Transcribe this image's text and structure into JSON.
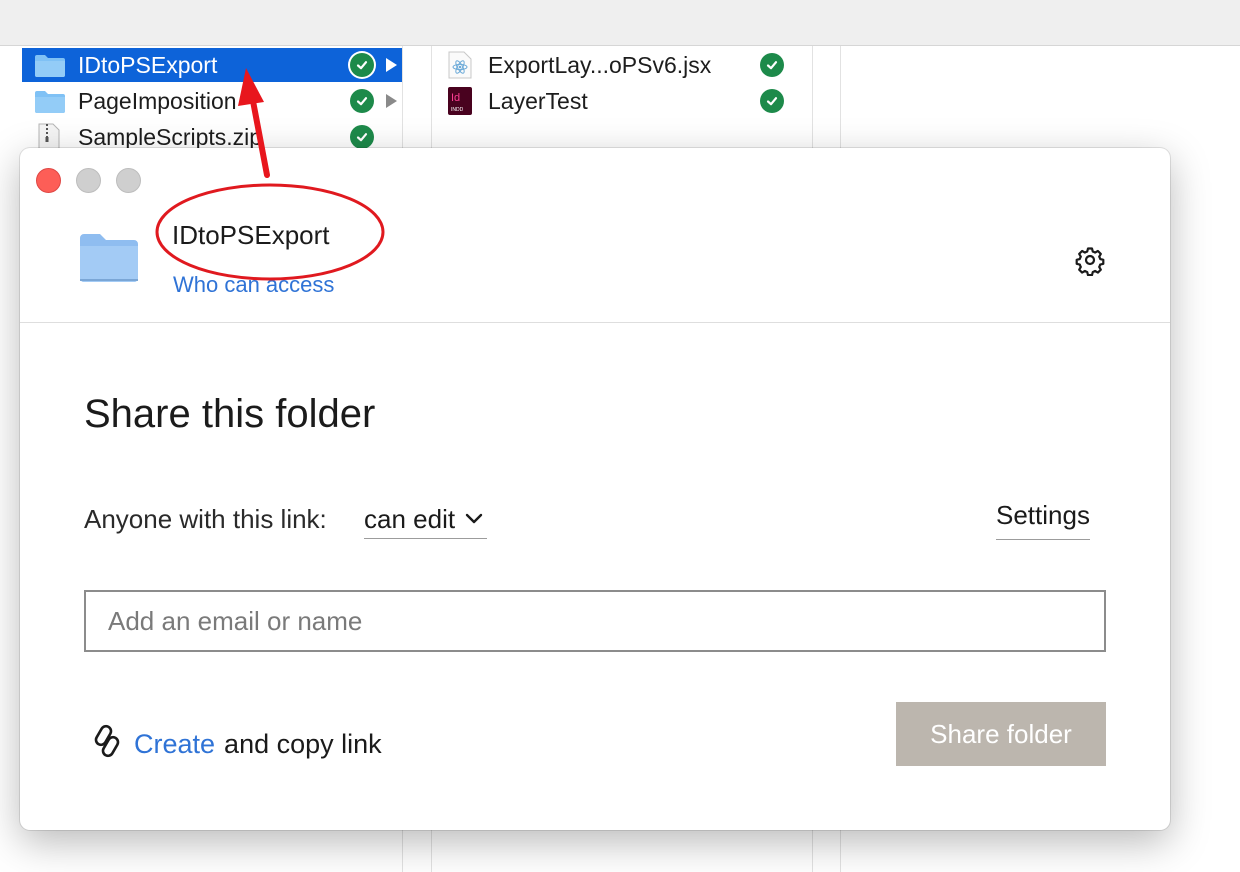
{
  "finder": {
    "column1": [
      {
        "name": "IDtoPSExport",
        "icon": "folder-icon",
        "synced": true,
        "has_children": true,
        "selected": true
      },
      {
        "name": "PageImposition",
        "icon": "folder-icon",
        "synced": true,
        "has_children": true,
        "selected": false
      },
      {
        "name": "SampleScripts.zip",
        "icon": "zip-file-icon",
        "synced": true,
        "has_children": false,
        "selected": false
      }
    ],
    "column2": [
      {
        "name": "ExportLay...oPSv6.jsx",
        "icon": "jsx-script-icon",
        "synced": true
      },
      {
        "name": "LayerTest",
        "icon": "indesign-document-icon",
        "synced": true
      }
    ]
  },
  "dialog": {
    "folder_name": "IDtoPSExport",
    "who_can_access": "Who can access",
    "heading": "Share this folder",
    "permission_label": "Anyone with this link:",
    "permission_value": "can edit",
    "settings_label": "Settings",
    "email_placeholder": "Add an email or name",
    "create_link_word": "Create",
    "create_link_rest": "and copy link",
    "share_button": "Share folder"
  },
  "colors": {
    "selection_blue": "#0d63d9",
    "sync_green": "#1d8a4a",
    "link_blue": "#2f73d6",
    "disabled_button": "#bcb6ae",
    "annotation_red": "#e0191f"
  }
}
